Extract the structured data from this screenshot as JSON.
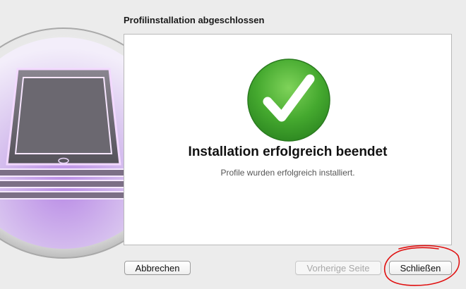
{
  "dialog": {
    "heading": "Profilinstallation abgeschlossen"
  },
  "content": {
    "success_icon": "checkmark-circle-icon",
    "title": "Installation erfolgreich beendet",
    "subtitle": "Profile wurden erfolgreich installiert."
  },
  "buttons": {
    "cancel_label": "Abbrechen",
    "back_label": "Vorherige Seite",
    "close_label": "Schließen"
  },
  "colors": {
    "success_green": "#3fa52b",
    "app_icon_purple": "#b57ee0",
    "annotation_red": "#e01010"
  }
}
